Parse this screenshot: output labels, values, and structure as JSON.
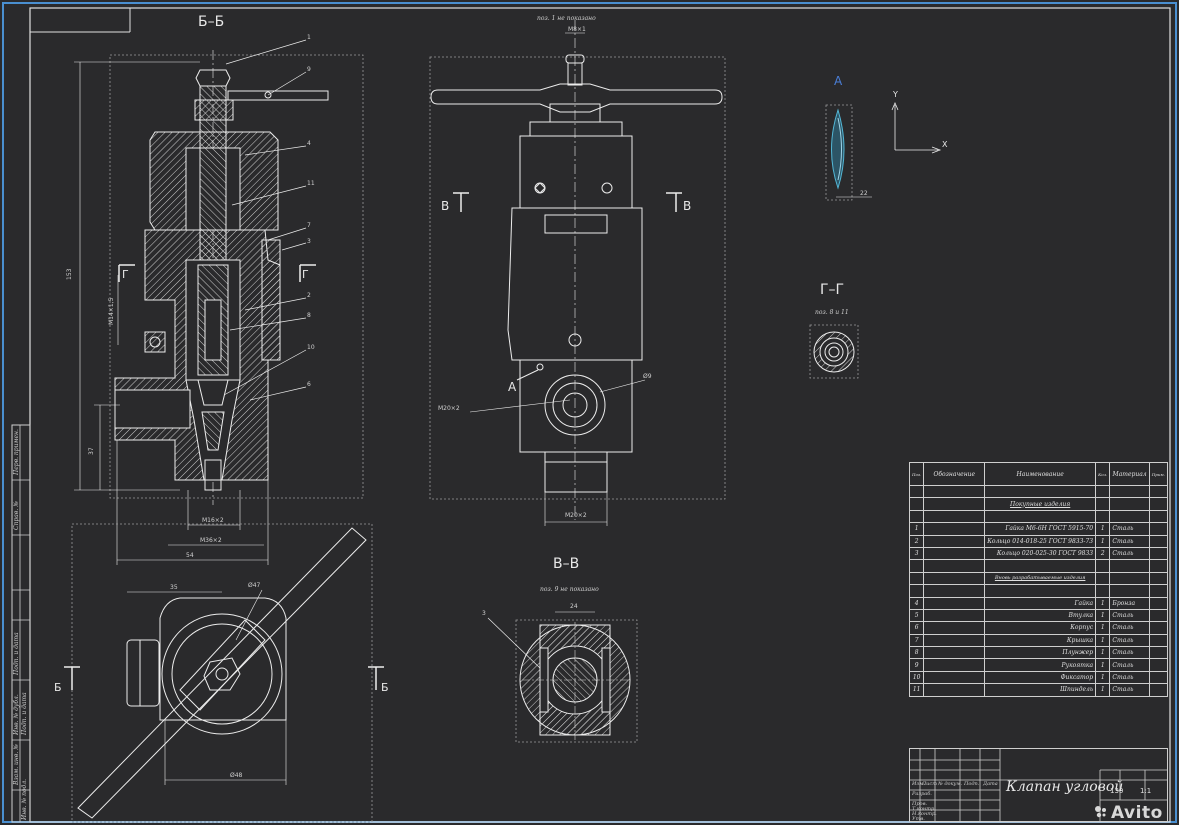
{
  "sections": {
    "bb": "Б–Б",
    "vv": "В–В",
    "gg": "Г–Г",
    "view_a": "А"
  },
  "notes": {
    "top_view": "поз. 1 не показано",
    "vv_note": "поз. 9 не показано",
    "gg_note": "поз. 8 и 11"
  },
  "markers": {
    "b_left": "Б",
    "b_right": "Б",
    "v_left": "В",
    "v_right": "В",
    "g_left": "Г",
    "g_right": "Г",
    "a": "А"
  },
  "axes": {
    "y": "Y",
    "x": "X"
  },
  "dimensions": {
    "overall_height": "153",
    "thread_m14": "M14×1,5",
    "height_37": "37",
    "m16": "M16×2",
    "m36": "M36×2",
    "width_54": "54",
    "m20": "M20×2",
    "m20b": "M20×2",
    "top_8": "M8×1",
    "dia_9": "Ø9",
    "d35": "35",
    "d47": "Ø47",
    "d48": "Ø48",
    "d24": "24",
    "a22": "22"
  },
  "leaders": [
    "1",
    "9",
    "4",
    "11",
    "7",
    "3",
    "2",
    "8",
    "10",
    "6"
  ],
  "leader_vv": "3",
  "bom": {
    "headers": {
      "zone": "Поз.",
      "designation": "Обозначение",
      "name": "Наименование",
      "qty": "Кол.",
      "material": "Материал",
      "note": "Прим."
    },
    "section_purchased": "Покупные изделия",
    "section_manufactured": "Вновь разрабатываемые изделия",
    "purchased": [
      {
        "pos": "1",
        "name": "Гайка М6-6Н ГОСТ 5915-70",
        "qty": "1",
        "material": "Сталь"
      },
      {
        "pos": "2",
        "name": "Кольцо 014-018-25 ГОСТ 9833-73",
        "qty": "1",
        "material": "Сталь"
      },
      {
        "pos": "3",
        "name": "Кольцо 020-025-30 ГОСТ 9833",
        "qty": "2",
        "material": "Сталь"
      }
    ],
    "manufactured": [
      {
        "pos": "4",
        "name": "Гайка",
        "qty": "1",
        "material": "Бронза"
      },
      {
        "pos": "5",
        "name": "Втулка",
        "qty": "1",
        "material": "Сталь"
      },
      {
        "pos": "6",
        "name": "Корпус",
        "qty": "1",
        "material": "Сталь"
      },
      {
        "pos": "7",
        "name": "Крышка",
        "qty": "1",
        "material": "Сталь"
      },
      {
        "pos": "8",
        "name": "Плунжер",
        "qty": "1",
        "material": "Сталь"
      },
      {
        "pos": "9",
        "name": "Рукоятка",
        "qty": "1",
        "material": "Сталь"
      },
      {
        "pos": "10",
        "name": "Фиксатор",
        "qty": "1",
        "material": "Сталь"
      },
      {
        "pos": "11",
        "name": "Шпиндель",
        "qty": "1",
        "material": "Сталь"
      }
    ]
  },
  "title_block": {
    "title": "Клапан угловой",
    "scale": "1:1",
    "mass": "130",
    "rows": [
      "Изм.",
      "Лист",
      "№ докум.",
      "Подп.",
      "Дата",
      "Разраб.",
      "Пров.",
      "Т.контр.",
      "Н.контр.",
      "Утв."
    ]
  },
  "side_stamps": [
    "Перв. примен.",
    "Справ. №",
    "Подп. и дата",
    "Инв. № дубл.",
    "Взам. инв. №",
    "Подп. и дата",
    "Инв. № подл."
  ],
  "watermark": "Avito",
  "colors": {
    "background": "#2a2a2c",
    "line": "#ececec",
    "frame": "#4a8fd0",
    "accent": "#4a7fd8",
    "cyan": "#53b7d6"
  }
}
